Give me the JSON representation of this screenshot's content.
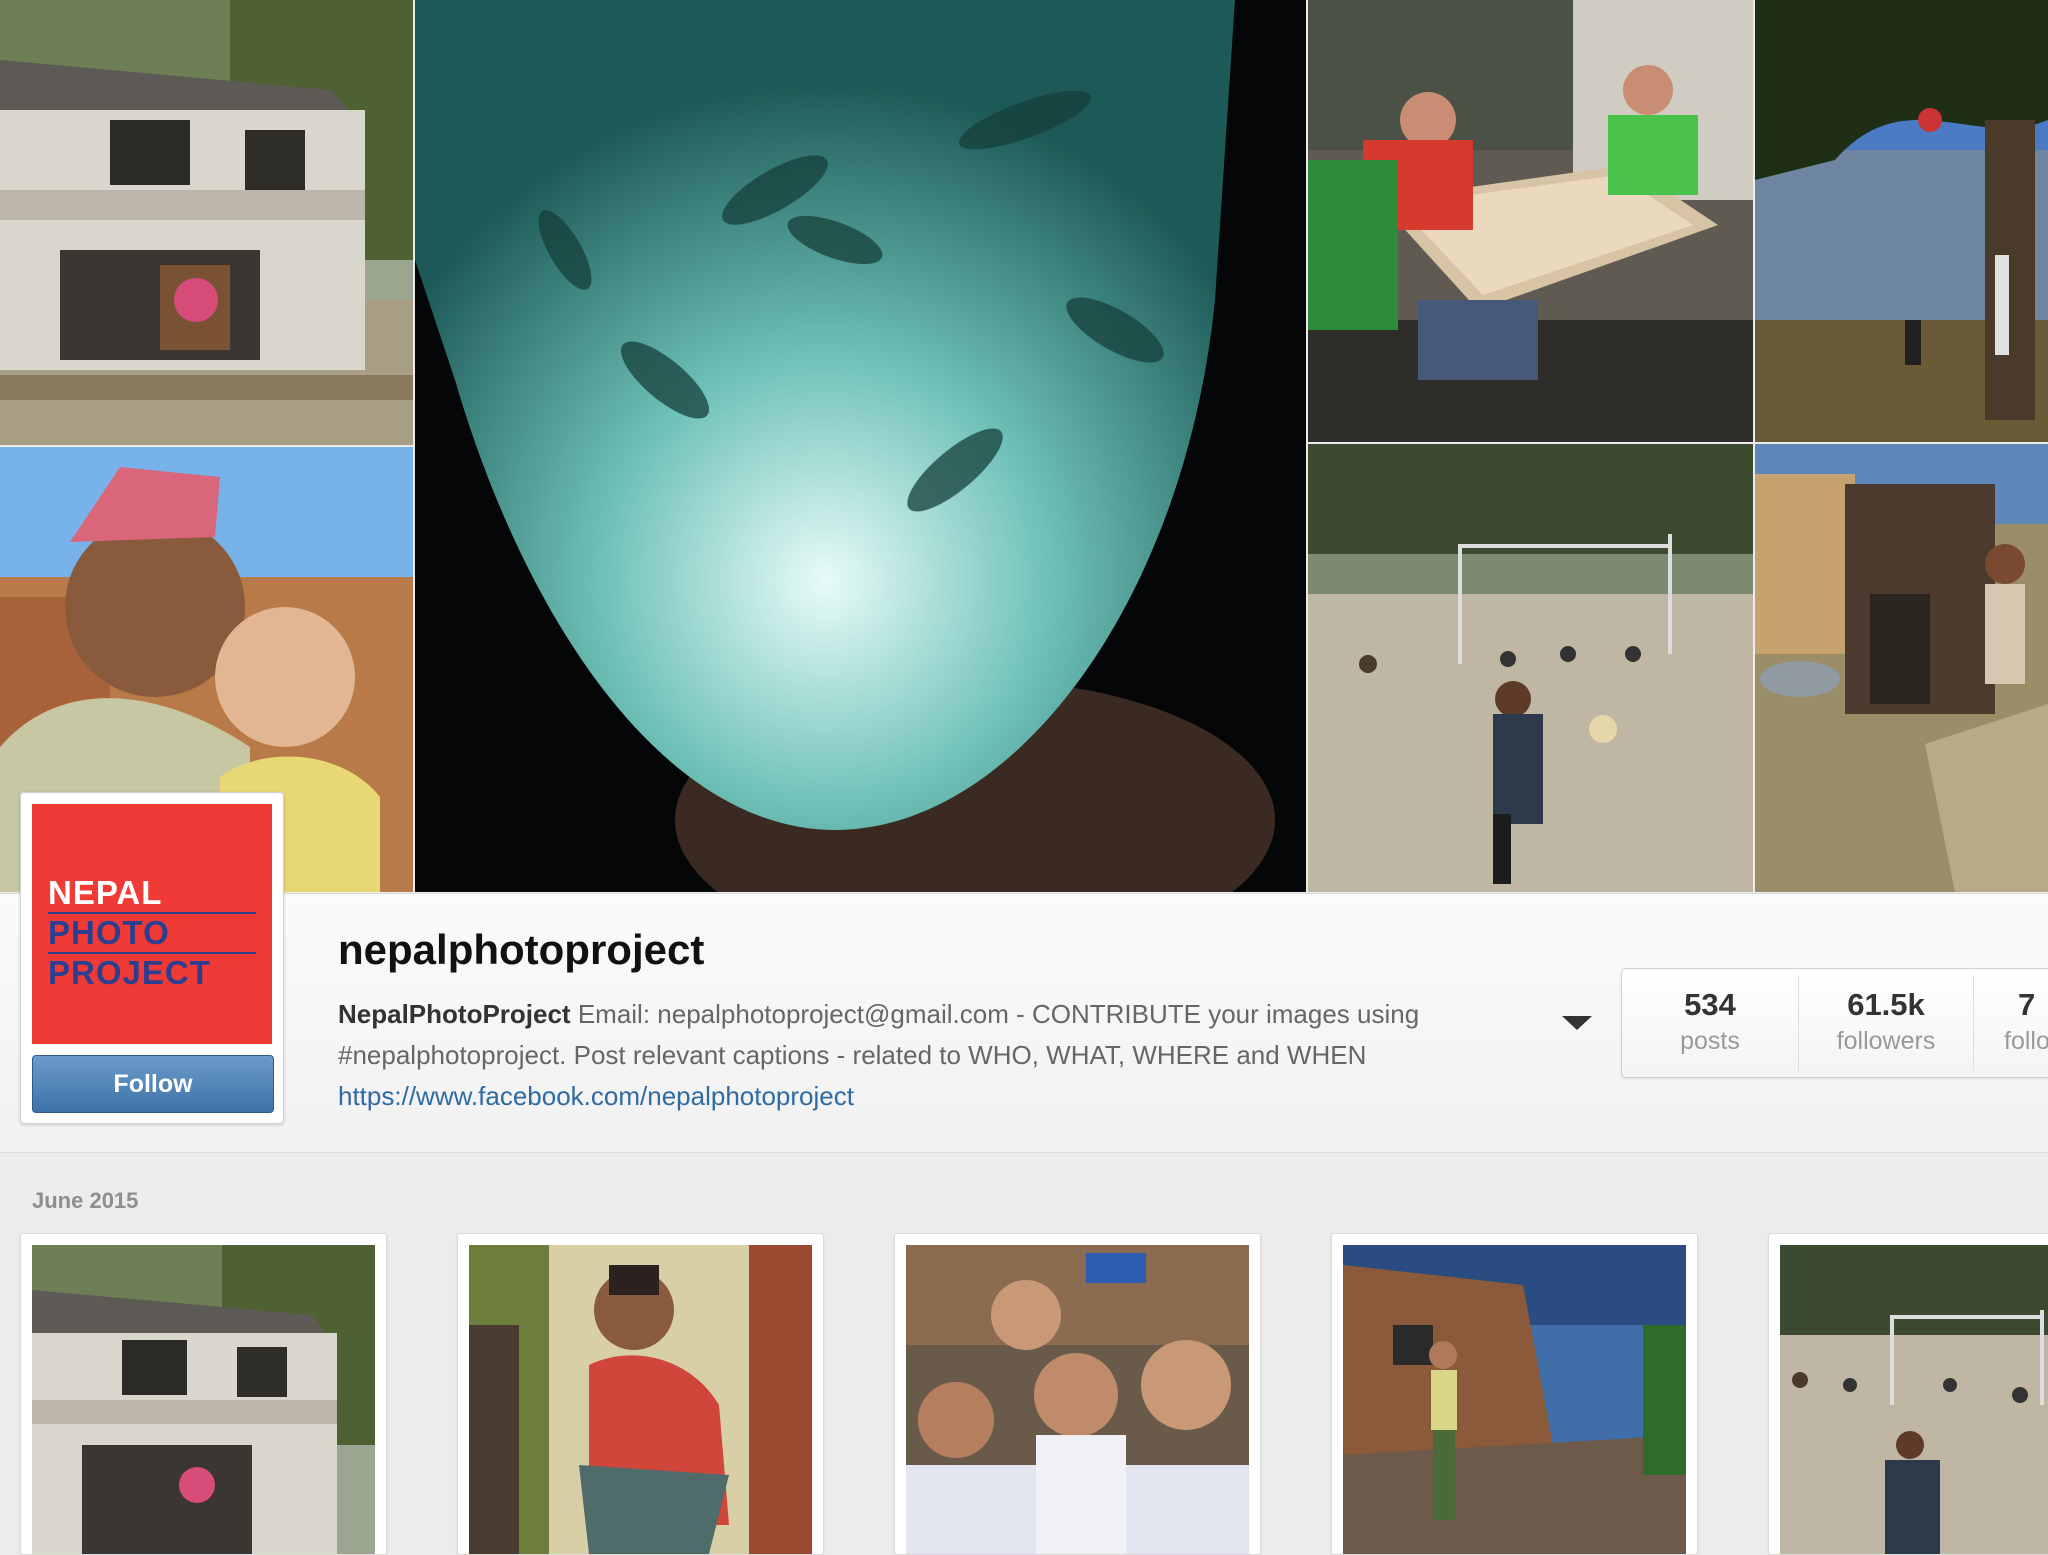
{
  "profile": {
    "username": "nepalphotoproject",
    "full_name": "NepalPhotoProject",
    "bio_text": " Email: nepalphotoproject@gmail.com - CONTRIBUTE your images using #nepalphotoproject. Post relevant captions - related to WHO, WHAT, WHERE and WHEN ",
    "link": "https://www.facebook.com/nepalphotoproject",
    "follow_label": "Follow",
    "logo": {
      "line1": "NEPAL",
      "line2": "PHOTO",
      "line3": "PROJECT",
      "bg_color": "#ef3a36",
      "text_color_1": "#ffffff",
      "text_color_2": "#2c3e8f"
    }
  },
  "stats": [
    {
      "value": "534",
      "label": "posts"
    },
    {
      "value": "61.5k",
      "label": "followers"
    },
    {
      "value": "7",
      "label": "follo"
    }
  ],
  "menu": {
    "icon": "caret-down-icon"
  },
  "feed": {
    "date_label": "June 2015",
    "photos": [
      {
        "subject": "damaged-house-with-flowers"
      },
      {
        "subject": "girl-crouching-by-brick-wall"
      },
      {
        "subject": "group-of-schoolchildren"
      },
      {
        "subject": "boy-standing-in-rubble"
      },
      {
        "subject": "boys-playing-football"
      }
    ]
  },
  "header_mosaic": [
    {
      "subject": "damaged-house-with-flowers"
    },
    {
      "subject": "glowing-paper-lantern"
    },
    {
      "subject": "boys-playing-carrom"
    },
    {
      "subject": "children-climbing-tree"
    },
    {
      "subject": "man-holding-baby"
    },
    {
      "subject": "boys-playing-football"
    },
    {
      "subject": "village-rubble"
    }
  ],
  "colors": {
    "accent_blue": "#3e72a8",
    "link_blue": "#2f6aa3",
    "page_bg": "#ececec"
  }
}
